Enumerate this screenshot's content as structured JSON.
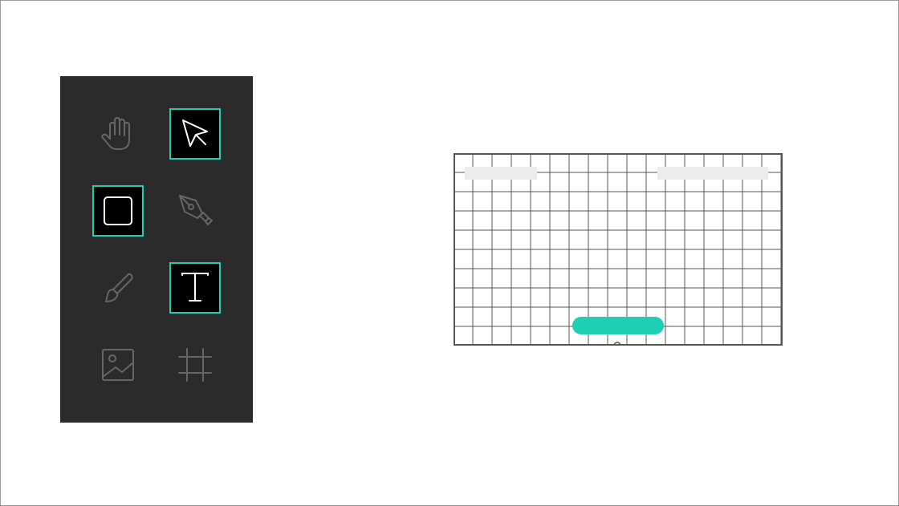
{
  "toolbar": {
    "tools": [
      {
        "id": "hand",
        "icon": "hand-icon",
        "active": false
      },
      {
        "id": "select",
        "icon": "cursor-arrow-icon",
        "active": true
      },
      {
        "id": "rectangle",
        "icon": "square-icon",
        "active": true
      },
      {
        "id": "pen",
        "icon": "pen-nib-icon",
        "active": false
      },
      {
        "id": "brush",
        "icon": "paintbrush-icon",
        "active": false
      },
      {
        "id": "text",
        "icon": "text-t-icon",
        "active": true
      },
      {
        "id": "image",
        "icon": "image-icon",
        "active": false
      },
      {
        "id": "frame",
        "icon": "frame-grid-icon",
        "active": false
      }
    ]
  },
  "canvas": {
    "grid": "on",
    "placeholders": [
      "text-placeholder-left",
      "text-placeholder-right"
    ],
    "action_pill": "teal-pill-button"
  },
  "colors": {
    "toolbar_bg": "#2b2b2b",
    "active_tool_bg": "#000000",
    "accent": "#1ecfb4",
    "inactive_icon": "#666666",
    "active_icon": "#ffffff",
    "grid_line": "#555555",
    "placeholder": "#ececec"
  }
}
